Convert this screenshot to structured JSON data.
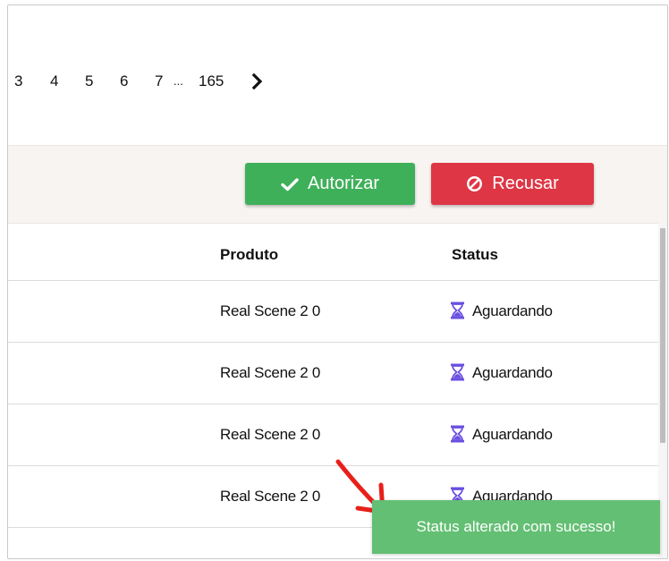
{
  "pagination": {
    "pages": [
      "3",
      "4",
      "5",
      "6",
      "7"
    ],
    "ellipsis": "...",
    "last_page": "165",
    "next_icon": "chevron-right-icon"
  },
  "actions": {
    "approve_label": "Autorizar",
    "approve_icon": "check-icon",
    "reject_label": "Recusar",
    "reject_icon": "ban-icon",
    "approve_color": "#3fb05a",
    "reject_color": "#de3645"
  },
  "table": {
    "columns": {
      "product": "Produto",
      "status": "Status"
    },
    "rows": [
      {
        "product": "Real Scene 2 0",
        "status": "Aguardando",
        "status_icon": "hourglass-icon"
      },
      {
        "product": "Real Scene 2 0",
        "status": "Aguardando",
        "status_icon": "hourglass-icon"
      },
      {
        "product": "Real Scene 2 0",
        "status": "Aguardando",
        "status_icon": "hourglass-icon"
      },
      {
        "product": "Real Scene 2 0",
        "status": "Aguardando",
        "status_icon": "hourglass-icon"
      }
    ]
  },
  "toast": {
    "message": "Status alterado com sucesso!",
    "color": "#63bf73"
  },
  "annotation": {
    "arrow_color": "#e8201a"
  }
}
